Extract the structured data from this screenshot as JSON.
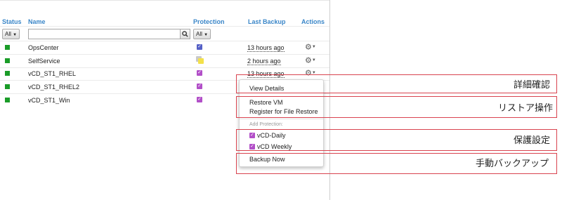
{
  "table": {
    "headers": {
      "status": "Status",
      "name": "Name",
      "protection": "Protection",
      "last_backup": "Last Backup",
      "actions": "Actions"
    },
    "filters": {
      "status": "All",
      "protection": "All"
    },
    "rows": [
      {
        "name": "OpsCenter",
        "protection": "blue-check",
        "last_backup": "13 hours ago"
      },
      {
        "name": "SelfService",
        "protection": "yellow-partial",
        "last_backup": "2 hours ago"
      },
      {
        "name": "vCD_ST1_RHEL",
        "protection": "purple-check",
        "last_backup": "13 hours ago"
      },
      {
        "name": "vCD_ST1_RHEL2",
        "protection": "purple-check",
        "last_backup": ""
      },
      {
        "name": "vCD_ST1_Win",
        "protection": "purple-check",
        "last_backup": ""
      }
    ]
  },
  "menu": {
    "view_details": "View Details",
    "restore_vm": "Restore VM",
    "register_file_restore": "Register for File Restore",
    "add_protection_label": "Add Protection:",
    "policies": [
      "vCD-Daily",
      "vCD Weekly"
    ],
    "backup_now": "Backup Now"
  },
  "annotations": [
    "詳細確認",
    "リストア操作",
    "保護設定",
    "手動バックアップ"
  ],
  "colors": {
    "header": "#3a86c8",
    "status_ok": "#1a9c28",
    "policy_purple": "#b24fc8",
    "policy_blue": "#5560c6",
    "annotation_red": "#d9434f"
  }
}
